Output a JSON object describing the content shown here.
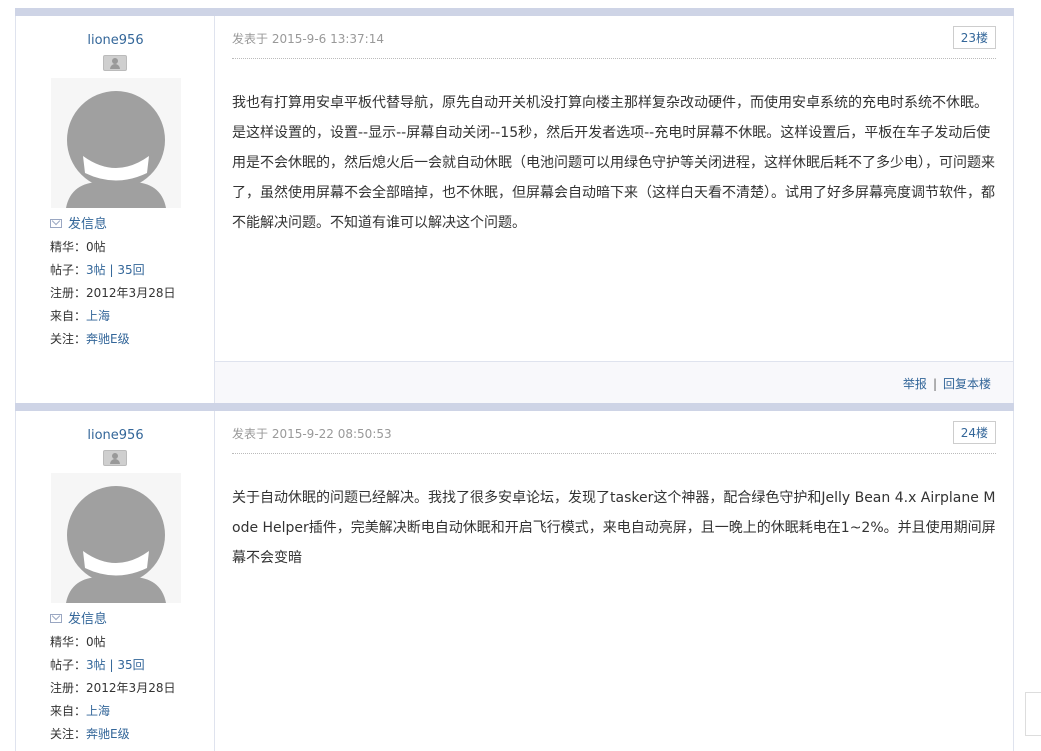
{
  "posts": [
    {
      "username": "lione956",
      "send_message": "发信息",
      "stats": {
        "digest_label": "精华：",
        "digest_value": "0帖",
        "posts_label": "帖子：",
        "posts_value": "3帖 | 35回",
        "registered_label": "注册：",
        "registered_value": "2012年3月28日",
        "from_label": "来自：",
        "from_value": "上海",
        "follow_label": "关注：",
        "follow_value": "奔驰E级"
      },
      "posted_at": "发表于 2015-9-6 13:37:14",
      "floor": "23楼",
      "message": "我也有打算用安卓平板代替导航，原先自动开关机没打算向楼主那样复杂改动硬件，而使用安卓系统的充电时系统不休眠。是这样设置的，设置--显示--屏幕自动关闭--15秒，然后开发者选项--充电时屏幕不休眠。这样设置后，平板在车子发动后使用是不会休眠的，然后熄火后一会就自动休眠（电池问题可以用绿色守护等关闭进程，这样休眠后耗不了多少电），可问题来了，虽然使用屏幕不会全部暗掉，也不休眠，但屏幕会自动暗下来（这样白天看不清楚）。试用了好多屏幕亮度调节软件，都不能解决问题。不知道有谁可以解决这个问题。",
      "report": "举报",
      "reply": "回复本楼"
    },
    {
      "username": "lione956",
      "send_message": "发信息",
      "stats": {
        "digest_label": "精华：",
        "digest_value": "0帖",
        "posts_label": "帖子：",
        "posts_value": "3帖 | 35回",
        "registered_label": "注册：",
        "registered_value": "2012年3月28日",
        "from_label": "来自：",
        "from_value": "上海",
        "follow_label": "关注：",
        "follow_value": "奔驰E级"
      },
      "posted_at": "发表于 2015-9-22 08:50:53",
      "floor": "24楼",
      "message": "关于自动休眠的问题已经解决。我找了很多安卓论坛，发现了tasker这个神器，配合绿色守护和Jelly Bean 4.x Airplane Mode Helper插件，完美解决断电自动休眠和开启飞行模式，来电自动亮屏，且一晚上的休眠耗电在1~2%。并且使用期间屏幕不会变暗"
    }
  ],
  "colors": {
    "link": "#336699",
    "separator": "#ced4e6",
    "border": "#dfe3ee",
    "avatar": "#a0a0a0"
  }
}
